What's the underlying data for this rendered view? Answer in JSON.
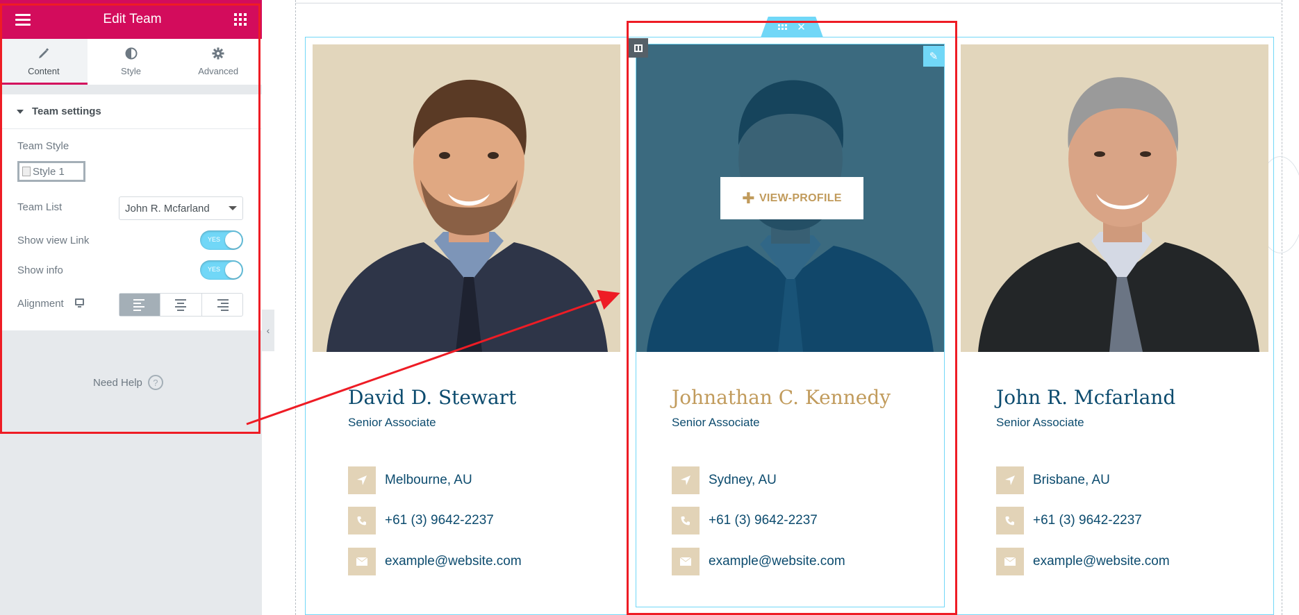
{
  "panel": {
    "title": "Edit Team",
    "tabs": [
      {
        "label": "Content",
        "icon": "pencil-icon",
        "active": true
      },
      {
        "label": "Style",
        "icon": "half-circle-icon",
        "active": false
      },
      {
        "label": "Advanced",
        "icon": "gear-icon",
        "active": false
      }
    ],
    "section_title": "Team settings",
    "team_style": {
      "label": "Team Style",
      "image_alt": "Style 1"
    },
    "team_list": {
      "label": "Team List",
      "value": "John R. Mcfarland"
    },
    "show_view_link": {
      "label": "Show view Link",
      "state": "YES"
    },
    "show_info": {
      "label": "Show info",
      "state": "YES"
    },
    "alignment": {
      "label": "Alignment",
      "options": [
        "left",
        "center",
        "right"
      ],
      "selected": "left"
    },
    "need_help": "Need Help",
    "help_icon": "?",
    "collapse_icon": "‹"
  },
  "canvas": {
    "view_profile": "VIEW-PROFILE",
    "plus_icon": "✚",
    "edit_icon": "✎",
    "close_icon": "✕",
    "cards": [
      {
        "name": "David D. Stewart",
        "role": "Senior Associate",
        "location": "Melbourne, AU",
        "phone": "+61 (3) 9642-2237",
        "email": "example@website.com"
      },
      {
        "name": "Johnathan C. Kennedy",
        "role": "Senior Associate",
        "location": "Sydney, AU",
        "phone": "+61 (3) 9642-2237",
        "email": "example@website.com"
      },
      {
        "name": "John R. Mcfarland",
        "role": "Senior Associate",
        "location": "Brisbane, AU",
        "phone": "+61 (3) 9642-2237",
        "email": "example@website.com"
      }
    ]
  },
  "colors": {
    "brand": "#d30c5c",
    "accent": "#71d7f7",
    "name_blue": "#0c4b6e",
    "gold": "#c19b5c",
    "icon_tile": "#e2d3b7",
    "annotation_red": "#ee1c25"
  }
}
